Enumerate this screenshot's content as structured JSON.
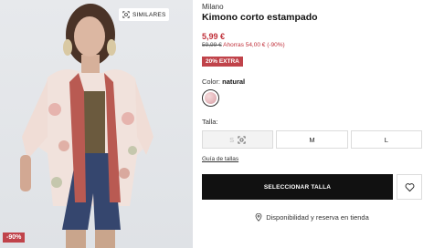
{
  "image": {
    "similares_label": "SIMILARES",
    "discount_badge": "-90%"
  },
  "product": {
    "brand": "Milano",
    "title": "Kimono corto estampado",
    "price": "5,99 €",
    "old_price": "59,99 €",
    "savings": "Ahorras 54,00 € (-90%)",
    "extra_badge": "20% EXTRA",
    "color_label": "Color:",
    "color_value": "natural",
    "swatch_color": "#e9c0c4",
    "size_label": "Talla:",
    "sizes": [
      {
        "label": "S",
        "available": false,
        "icon": "similar-icon"
      },
      {
        "label": "M",
        "available": true
      },
      {
        "label": "L",
        "available": true
      }
    ],
    "size_guide": "Guía de tallas",
    "select_button": "SELECCIONAR TALLA",
    "availability": "Disponibilidad y reserva en tienda"
  },
  "colors": {
    "accent_red": "#c0434a",
    "price_red": "#c0303a",
    "button_black": "#111111"
  }
}
